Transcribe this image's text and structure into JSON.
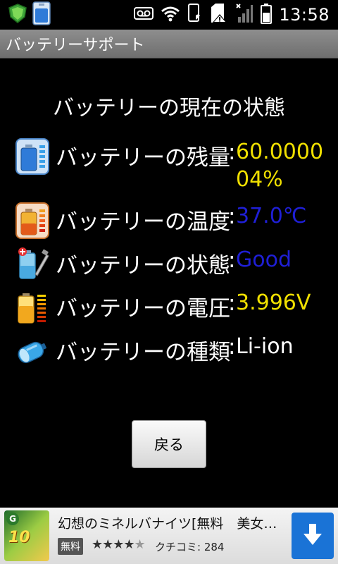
{
  "status_bar": {
    "time": "13:58",
    "left_icons": [
      "shield-app-icon",
      "battery-app-icon"
    ],
    "right_icons": [
      "voicemail-icon",
      "wifi-icon",
      "phone-icon",
      "sd-card-warning-icon",
      "signal-icon",
      "battery-icon"
    ]
  },
  "title_bar": {
    "title": "バッテリーサポート"
  },
  "content": {
    "heading": "バッテリーの現在の状態",
    "rows": [
      {
        "label": "バッテリーの残量",
        "colon": ":",
        "value_line1": "60.0000",
        "value_line2": "04%",
        "color": "#f0e000",
        "icon": "battery-level-icon"
      },
      {
        "label": "バッテリーの温度",
        "colon": ":",
        "value": "37.0℃",
        "color": "#1f1fd6",
        "icon": "battery-temperature-icon"
      },
      {
        "label": "バッテリーの状態",
        "colon": ":",
        "value": "Good",
        "color": "#1f1fd6",
        "icon": "battery-health-icon"
      },
      {
        "label": "バッテリーの電圧",
        "colon": ":",
        "value": "3.996V",
        "color": "#f0e000",
        "icon": "battery-voltage-icon"
      },
      {
        "label": "バッテリーの種類",
        "colon": ":",
        "value": "Li-ion",
        "color": "#ffffff",
        "icon": "battery-type-icon"
      }
    ]
  },
  "back_button": {
    "label": "戻る"
  },
  "ad": {
    "title": "幻想のミネルバナイツ[無料　美女…",
    "thumb_badge": "G",
    "thumb_text": "10",
    "free_label": "無料",
    "stars": "★★★★",
    "stars_empty": "★",
    "review_label": "クチコミ: 284",
    "download_icon": "download-arrow-icon"
  }
}
